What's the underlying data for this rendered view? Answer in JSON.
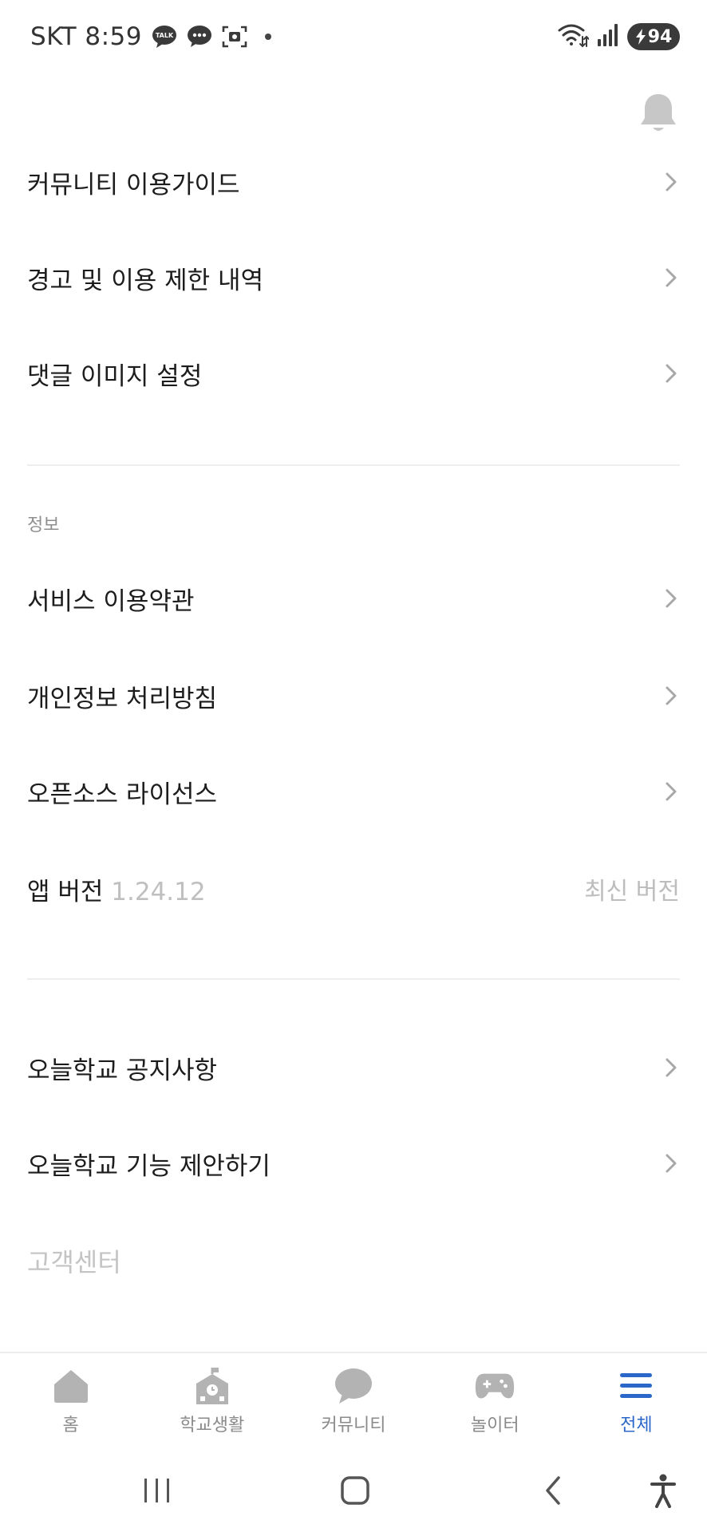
{
  "status_bar": {
    "carrier_time": "SKT 8:59",
    "talk_badge": "TALK",
    "battery": "94",
    "icons": [
      "kakaotalk-icon",
      "message-icon",
      "screenshot-icon",
      "wifi-icon",
      "signal-icon",
      "battery-icon"
    ]
  },
  "header": {
    "bell_icon": "bell-icon"
  },
  "menu_group_1": [
    {
      "label": "커뮤니티 이용가이드"
    },
    {
      "label": "경고 및 이용 제한 내역"
    },
    {
      "label": "댓글 이미지 설정"
    }
  ],
  "info_section": {
    "title": "정보",
    "items": [
      {
        "label": "서비스 이용약관"
      },
      {
        "label": "개인정보 처리방침"
      },
      {
        "label": "오픈소스 라이선스"
      }
    ],
    "version": {
      "label": "앱 버전",
      "number": "1.24.12",
      "status": "최신 버전"
    }
  },
  "menu_group_2": [
    {
      "label": "오늘학교 공지사항"
    },
    {
      "label": "오늘학교 기능 제안하기"
    }
  ],
  "customer_center": {
    "label": "고객센터"
  },
  "bottom_nav": {
    "items": [
      {
        "label": "홈",
        "icon": "home-icon"
      },
      {
        "label": "학교생활",
        "icon": "school-icon"
      },
      {
        "label": "커뮤니티",
        "icon": "chat-bubble-icon"
      },
      {
        "label": "놀이터",
        "icon": "gamepad-icon"
      },
      {
        "label": "전체",
        "icon": "menu-icon"
      }
    ],
    "active_index": 4
  },
  "colors": {
    "accent": "#2a67c9",
    "inactive_icon": "#b3b3b3",
    "text": "#1c1c1c",
    "muted": "#8e8e8e"
  }
}
